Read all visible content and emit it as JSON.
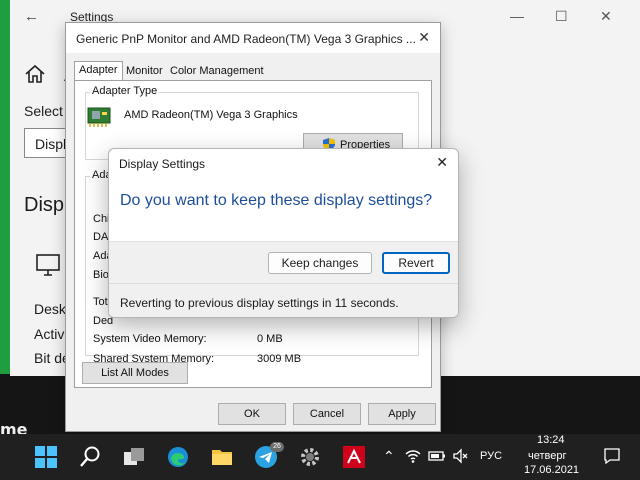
{
  "settings": {
    "title": "Settings",
    "frag_a": "A",
    "frag_select": "Select",
    "frag_disp_input": "Displ",
    "frag_display_heading": "Displ",
    "frag_desktop": "Deskt",
    "frag_active": "Active",
    "frag_bitdepth": "Bit de"
  },
  "props": {
    "title": "Generic PnP Monitor and AMD Radeon(TM) Vega 3 Graphics ...",
    "tabs": [
      "Adapter",
      "Monitor",
      "Color Management"
    ],
    "adapter_type_label": "Adapter Type",
    "adapter_name": "AMD Radeon(TM) Vega 3 Graphics",
    "properties_button": "Properties",
    "adapter_info_label": "Ada",
    "info_frags": [
      "Chip",
      "DAC",
      "Ada",
      "Bios"
    ],
    "total_frag": "Tot",
    "ded_frag": "Ded",
    "system_video_memory_label": "System Video Memory:",
    "system_video_memory_value": "0 MB",
    "shared_memory_label": "Shared System Memory:",
    "shared_memory_value": "3009 MB",
    "list_modes_button": "List All Modes",
    "ok": "OK",
    "cancel": "Cancel",
    "apply": "Apply"
  },
  "confirm": {
    "title": "Display Settings",
    "question": "Do you want to keep these display settings?",
    "keep": "Keep changes",
    "revert": "Revert",
    "countdown": "Reverting to previous display settings in 11 seconds."
  },
  "taskbar": {
    "telegram_badge": "26",
    "language": "РУС",
    "time": "13:24",
    "day": "четверг",
    "date": "17.06.2021"
  },
  "desktop": {
    "dark_text": "me"
  },
  "colors": {
    "accent": "#0067c0",
    "question_text": "#1e4e9a",
    "taskbar": "#202020",
    "desktop_green": "#1f9e3f"
  }
}
